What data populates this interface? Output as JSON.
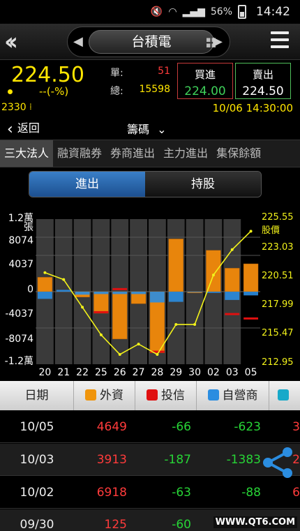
{
  "status": {
    "battery": "56%",
    "time": "14:42"
  },
  "title": {
    "stock_name": "台積電"
  },
  "quote": {
    "price": "224.50",
    "change": "--(-%)",
    "unit_label": "單:",
    "unit_value": "51",
    "total_label": "總:",
    "total_value": "15598",
    "buy_label": "買進",
    "buy_value": "224.00",
    "sell_label": "賣出",
    "sell_value": "224.50",
    "code": "2330",
    "datetime": "10/06 14:30:00"
  },
  "nav": {
    "back_label": "返回",
    "chips_label": "籌碼"
  },
  "tabs": [
    {
      "label": "三大法人"
    },
    {
      "label": "融資融券"
    },
    {
      "label": "券商進出"
    },
    {
      "label": "主力進出"
    },
    {
      "label": "集保餘額"
    }
  ],
  "toggle": {
    "left": "進出",
    "right": "持股"
  },
  "chart_data": {
    "type": "bar",
    "categories": [
      "20",
      "21",
      "22",
      "25",
      "26",
      "27",
      "28",
      "29",
      "30",
      "02",
      "03",
      "05"
    ],
    "left_axis": {
      "labels": [
        "1.2萬",
        "張",
        "8074",
        "4037",
        "0",
        "-4037",
        "-8074",
        "-1.2萬"
      ],
      "ylim": [
        -12111,
        12111
      ]
    },
    "right_axis": {
      "labels": [
        "225.55",
        "股價",
        "223.03",
        "220.51",
        "217.99",
        "215.47",
        "212.95"
      ],
      "ylim": [
        212.95,
        225.55
      ]
    },
    "series": [
      {
        "name": "外資",
        "color": "#e8850c",
        "values": [
          2400,
          0,
          -900,
          -3600,
          -7900,
          -2000,
          -10200,
          8800,
          -200,
          6900,
          3913,
          4649
        ]
      },
      {
        "name": "投信",
        "color": "#e01010",
        "values": [
          0,
          0,
          0,
          -300,
          600,
          0,
          -800,
          0,
          0,
          0,
          -187,
          -66
        ]
      },
      {
        "name": "自營商",
        "color": "#2b8de0",
        "values": [
          -1200,
          300,
          -500,
          -400,
          -400,
          -400,
          -1800,
          -1700,
          -100,
          -200,
          -1383,
          -623
        ]
      }
    ],
    "price_series": {
      "name": "股價",
      "color": "#f2f21a",
      "values": [
        220.9,
        220.3,
        217.9,
        215.5,
        213.8,
        214.7,
        213.8,
        216.4,
        216.4,
        220.7,
        222.9,
        224.5
      ]
    }
  },
  "table": {
    "headers": [
      {
        "label": "日期"
      },
      {
        "label": "外資",
        "color": "#f0950c"
      },
      {
        "label": "投信",
        "color": "#e01010"
      },
      {
        "label": "自營商",
        "color": "#2b8de0"
      },
      {
        "label": "",
        "color": "#18a9c9"
      }
    ],
    "rows": [
      {
        "date": "10/05",
        "foreign": "4649",
        "trust": "-66",
        "dealer": "-623",
        "extra": "3"
      },
      {
        "date": "10/03",
        "foreign": "3913",
        "trust": "-187",
        "dealer": "-1383",
        "extra": "2"
      },
      {
        "date": "10/02",
        "foreign": "6918",
        "trust": "-63",
        "dealer": "-88",
        "extra": "6"
      },
      {
        "date": "09/30",
        "foreign": "125",
        "trust": "-60",
        "dealer": "",
        "extra": ""
      }
    ]
  },
  "watermark": "WWW.QT6.COM"
}
